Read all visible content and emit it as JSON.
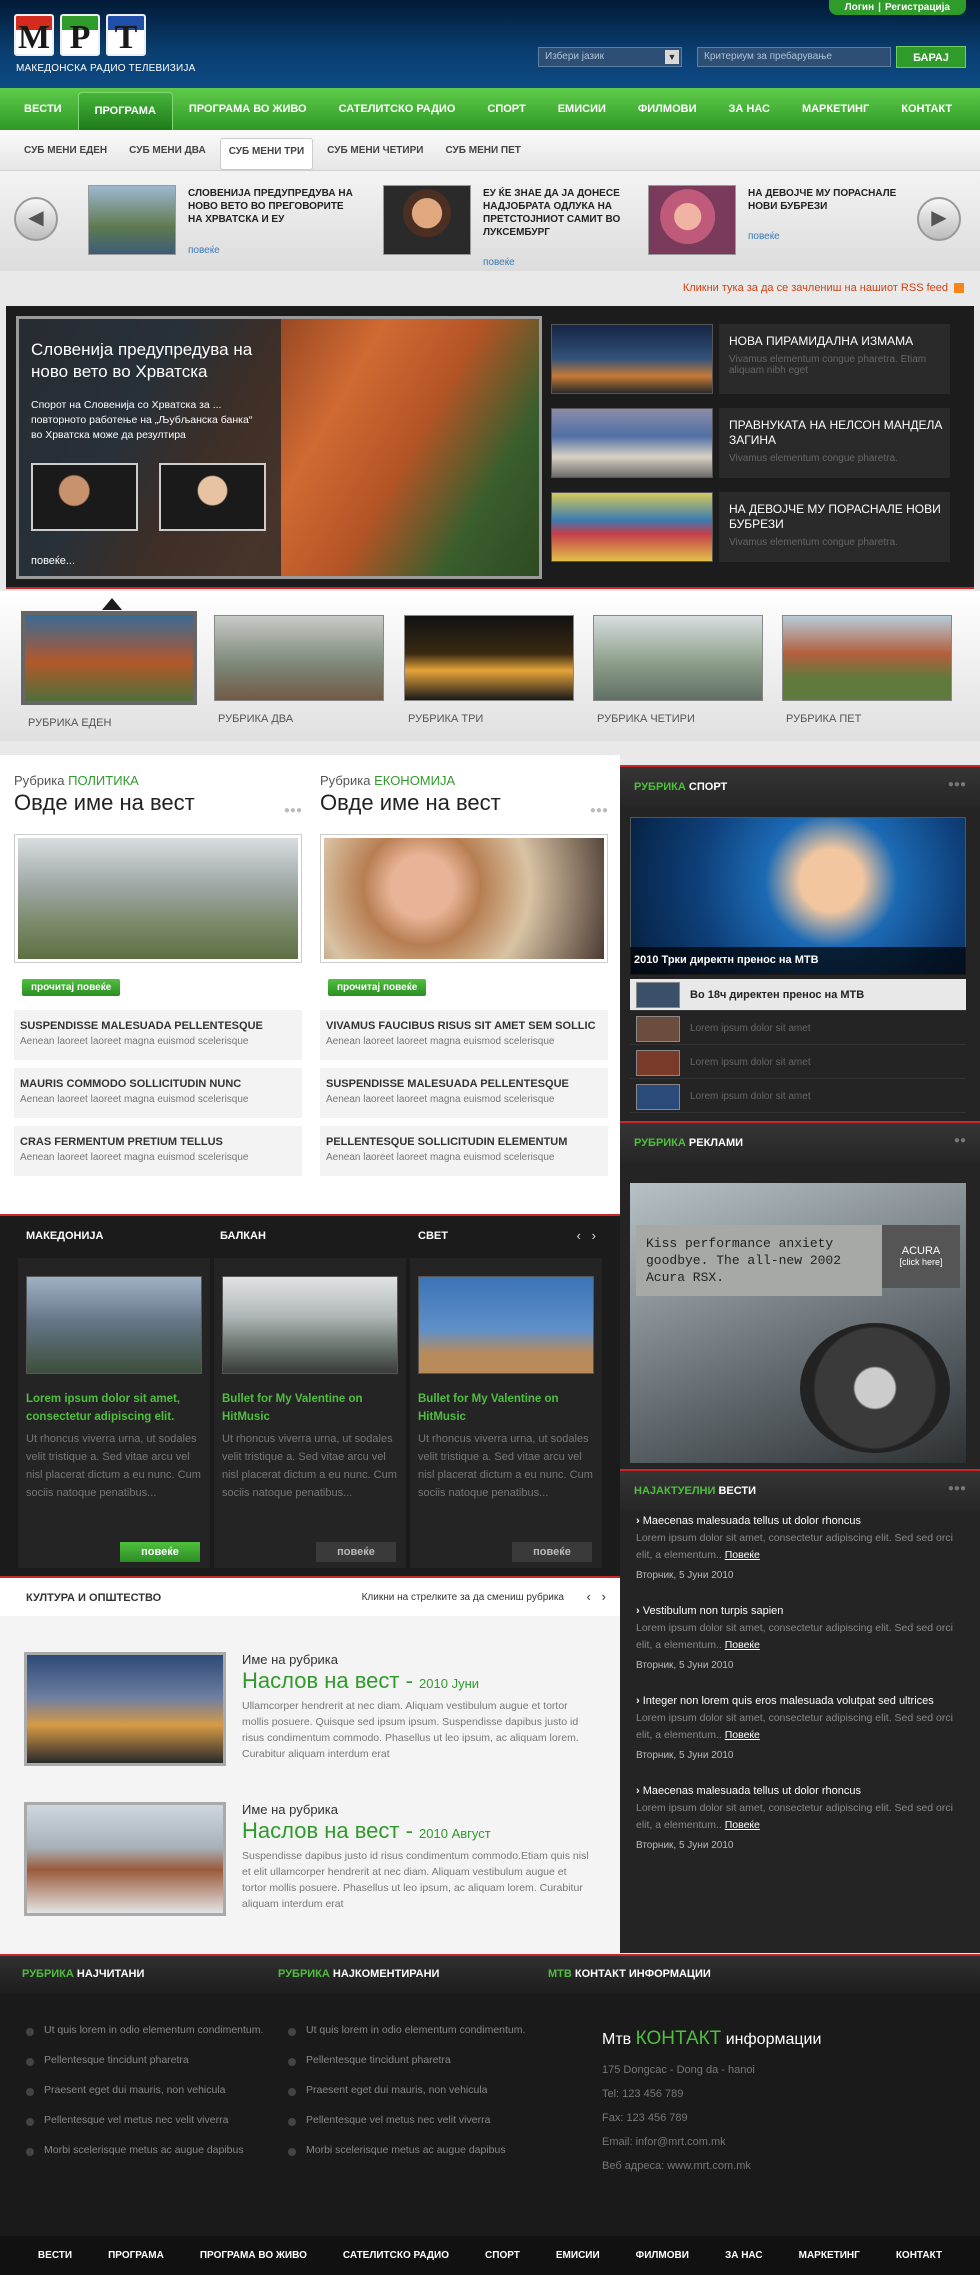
{
  "header": {
    "logo_letters": [
      "М",
      "Р",
      "Т"
    ],
    "logo_sub": "МАКЕДОНСКА РАДИО ТЕЛЕВИЗИЈА",
    "login": "Логин",
    "register": "Регистрација",
    "lang": "Избери јазик",
    "search_placeholder": "Критериум за пребарување",
    "search_btn": "БАРАЈ"
  },
  "nav": [
    "ВЕСТИ",
    "ПРОГРАМА",
    "ПРОГРАМА ВО ЖИВО",
    "САТЕЛИТСКО РАДИО",
    "СПОРТ",
    "ЕМИСИИ",
    "ФИЛМОВИ",
    "ЗА НАС",
    "МАРКЕТИНГ",
    "КОНТАКТ"
  ],
  "subnav": [
    "СУБ МЕНИ ЕДЕН",
    "СУБ МЕНИ ДВА",
    "СУБ МЕНИ ТРИ",
    "СУБ МЕНИ ЧЕТИРИ",
    "СУБ МЕНИ ПЕТ"
  ],
  "teasers": [
    {
      "title": "СЛОВЕНИЈА ПРЕДУПРЕДУВА НА НОВО ВЕТО ВО ПРЕГОВОРИТЕ НА ХРВАТСКА И ЕУ",
      "more": "повеќе"
    },
    {
      "title": "ЕУ ЌЕ ЗНАЕ ДА ЈА ДОНЕСЕ НАДЈОБРАТА ОДЛУКА НА ПРЕТСТОЈНИОТ САМИТ ВО ЛУКСЕМБУРГ",
      "more": "повеќе"
    },
    {
      "title": "НА ДЕВОЈЧЕ МУ ПОРАСНАЛЕ НОВИ БУБРЕЗИ",
      "more": "повеќе"
    }
  ],
  "rss": "Кликни тука за да се зачлениш на нашиот RSS feed",
  "featured": {
    "title": "Словенија предупредува на ново вето во Хрватска",
    "text": "Спорот на Словенија со Хрватска за ... повторното работење на „Љубљанска банка“ во Хрватска може да резултира",
    "more": "повеќе...",
    "items": [
      {
        "title": "НОВА ПИРАМИДАЛНА ИЗМАМА",
        "desc": "Vivamus elementum congue pharetra. Etiam aliquam nibh eget"
      },
      {
        "title": "ПРАВНУКАТА НА НЕЛСОН МАНДЕЛА ЗАГИНА",
        "desc": "Vivamus elementum congue pharetra."
      },
      {
        "title": "НА ДЕВОЈЧЕ МУ ПОРАСНАЛЕ НОВИ БУБРЕЗИ",
        "desc": "Vivamus elementum congue pharetra."
      }
    ]
  },
  "rubrics": [
    "РУБРИКА ЕДЕН",
    "РУБРИКА ДВА",
    "РУБРИКА ТРИ",
    "РУБРИКА ЧЕТИРИ",
    "РУБРИКА ПЕТ"
  ],
  "news_cols": [
    {
      "prefix": "Рубрика",
      "cat": "ПОЛИТИКА",
      "title": "Овде име на вест",
      "btn": "прочитај повеќе",
      "items": [
        {
          "t": "SUSPENDISSE MALESUADA PELLENTESQUE",
          "d": "Aenean laoreet laoreet magna euismod scelerisque"
        },
        {
          "t": "MAURIS COMMODO SOLLICITUDIN NUNC",
          "d": "Aenean laoreet laoreet magna euismod scelerisque"
        },
        {
          "t": "CRAS FERMENTUM PRETIUM TELLUS",
          "d": "Aenean laoreet laoreet magna euismod scelerisque"
        }
      ]
    },
    {
      "prefix": "Рубрика",
      "cat": "ЕКОНОМИЈА",
      "title": "Овде име на вест",
      "btn": "прочитај повеќе",
      "items": [
        {
          "t": "VIVAMUS FAUCIBUS RISUS SIT AMET SEM SOLLIC",
          "d": "Aenean laoreet laoreet magna euismod scelerisque"
        },
        {
          "t": "SUSPENDISSE MALESUADA PELLENTESQUE",
          "d": "Aenean laoreet laoreet magna euismod scelerisque"
        },
        {
          "t": "PELLENTESQUE SOLLICITUDIN ELEMENTUM",
          "d": "Aenean laoreet laoreet magna euismod scelerisque"
        }
      ]
    }
  ],
  "sport": {
    "head_a": "РУБРИКА",
    "head_b": "СПОРТ",
    "caption": "2010 Трки директн пренос на МТВ",
    "rows": [
      "Во 18ч директен пренос на МТВ",
      "Lorem ipsum dolor sit amet",
      "Lorem ipsum dolor sit amet",
      "Lorem ipsum dolor sit amet"
    ]
  },
  "ads": {
    "head_a": "РУБРИКА",
    "head_b": "РЕКЛАМИ",
    "text": "Kiss performance anxiety goodbye. The all-new 2002 Acura RSX.",
    "brand": "ACURA",
    "click": "[click here]"
  },
  "latest": {
    "head_a": "НАЈАКТУЕЛНИ",
    "head_b": "ВЕСТИ",
    "items": [
      {
        "t": "Maecenas malesuada tellus ut dolor rhoncus",
        "p": "Lorem ipsum dolor sit amet, consectetur adipiscing elit. Sed sed orci elit, a elementum..",
        "more": "Повеќе",
        "d": "Вторник, 5 Јуни 2010"
      },
      {
        "t": "Vestibulum non turpis sapien",
        "p": "Lorem ipsum dolor sit amet, consectetur adipiscing elit. Sed sed orci elit, a elementum..",
        "more": "Повеќе",
        "d": "Вторник, 5 Јуни 2010"
      },
      {
        "t": "Integer non lorem quis eros malesuada volutpat sed ultrices",
        "p": "Lorem ipsum dolor sit amet, consectetur adipiscing elit. Sed sed orci elit, a elementum..",
        "more": "Повеќе",
        "d": "Вторник, 5 Јуни 2010"
      },
      {
        "t": "Maecenas malesuada tellus ut dolor rhoncus",
        "p": "Lorem ipsum dolor sit amet, consectetur adipiscing elit. Sed sed orci elit, a elementum..",
        "more": "Повеќе",
        "d": "Вторник, 5 Јуни 2010"
      }
    ]
  },
  "regions": {
    "tabs": [
      "МАКЕДОНИЈА",
      "БАЛКАН",
      "СВЕТ"
    ],
    "cols": [
      {
        "title": "Lorem ipsum dolor sit amet, consectetur adipiscing elit.",
        "text": "Ut rhoncus viverra urna, ut sodales velit tristique a. Sed vitae arcu vel nisl placerat dictum a eu nunc. Cum sociis natoque penatibus...",
        "btn": "повеќе"
      },
      {
        "title": "Bullet for My Valentine on HitMusic",
        "text": "Ut rhoncus viverra urna, ut sodales velit tristique a. Sed vitae arcu vel nisl placerat dictum a eu nunc. Cum sociis natoque penatibus...",
        "btn": "повеќе"
      },
      {
        "title": "Bullet for My Valentine on HitMusic",
        "text": "Ut rhoncus viverra urna, ut sodales velit tristique a. Sed vitae arcu vel nisl placerat dictum a eu nunc. Cum sociis natoque penatibus...",
        "btn": "повеќе"
      }
    ]
  },
  "culture": {
    "title": "КУЛТУРА И ОПШТЕСТВО",
    "hint": "Кликни на стрелките за да смениш рубрика",
    "items": [
      {
        "r": "Име на рубрика",
        "h": "Наслов на вест - ",
        "date": "2010 Јуни",
        "p": "Ullamcorper hendrerit at nec diam. Aliquam vestibulum augue et tortor mollis posuere. Quisque sed ipsum ipsum. Suspendisse dapibus justo id risus condimentum commodo. Phasellus ut leo ipsum, ac aliquam lorem. Curabitur aliquam interdum erat"
      },
      {
        "r": "Име на рубрика",
        "h": "Наслов на вест - ",
        "date": "2010 Август",
        "p": "Suspendisse dapibus justo id risus condimentum commodo.Etiam quis nisl et elit ullamcorper hendrerit at nec diam. Aliquam vestibulum augue et tortor mollis posuere. Phasellus ut leo ipsum, ac aliquam lorem. Curabitur aliquam interdum erat"
      }
    ]
  },
  "footer": {
    "h1a": "РУБРИКА",
    "h1b": "НАЈЧИТАНИ",
    "h2a": "РУБРИКА",
    "h2b": "НАЈКОМЕНТИРАНИ",
    "h3a": "МТВ",
    "h3b": "КОНТАКТ ИНФОРМАЦИИ",
    "list": [
      "Ut quis lorem in odio elementum condimentum.",
      "Pellentesque tincidunt pharetra",
      "Praesent eget dui mauris, non vehicula",
      "Pellentesque vel metus nec velit viverra",
      "Morbi scelerisque metus ac augue dapibus"
    ],
    "contact_a": "Мтв ",
    "contact_b": "КОНТАКТ",
    "contact_c": " информации",
    "contact": [
      "175 Dongcac - Dong da - hanoi",
      "Tel: 123 456 789",
      "Fax: 123 456 789",
      "Email: infor@mrt.com.mk",
      "Веб адреса: www.mrt.com.mk"
    ]
  }
}
